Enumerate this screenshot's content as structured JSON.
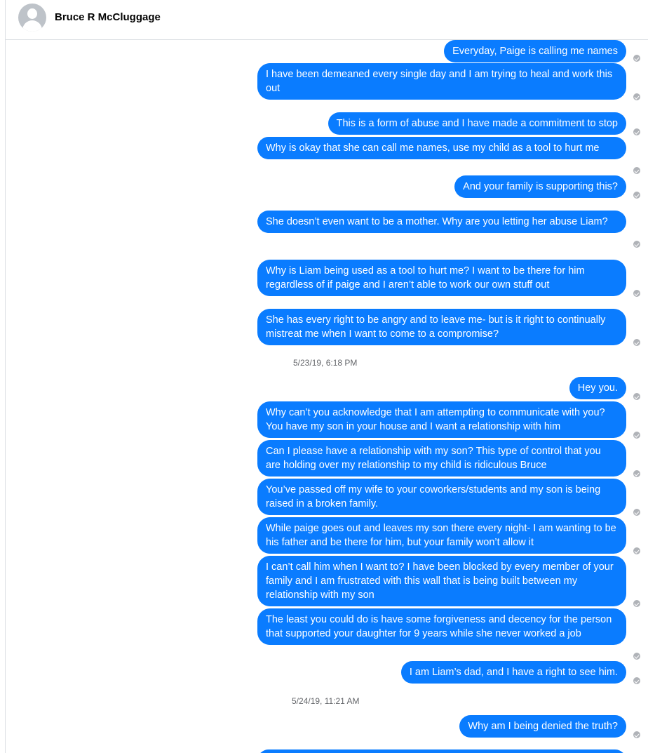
{
  "contact": {
    "name": "Bruce R McCluggage"
  },
  "messages": [
    "Everyday, Paige is calling me names",
    "I have been demeaned every single day and I am trying to heal and work this out",
    "This is a form of abuse and I have made a commitment to stop",
    "Why is okay that she can call me names, use my child as a tool to hurt me",
    "And your family is supporting this?",
    "She doesn’t even want to be a mother. Why are you letting her abuse Liam?",
    "Why is Liam being used as a tool to hurt me? I want to be there for him regardless of if paige and I aren’t able to work our own stuff out",
    "She has every right to be angry and to leave me- but is it right to continually mistreat me when I want to come to a compromise?",
    "Hey you.",
    "Why can’t you acknowledge that I am attempting to communicate with you? You have my son in your house and I want a relationship with him",
    "Can I please have a relationship with my son? This type of control that you are holding over my relationship to my child is ridiculous Bruce",
    "You’ve passed off my wife to your coworkers/students and my son is being raised in a broken family.",
    "While paige goes out and leaves my son there every night- I am wanting to be his father and be there for him, but your family won’t allow it",
    "I can’t call him when I want to? I have been blocked by every member of your family and I am frustrated with this wall that is being built between my relationship with my son",
    "The least you could do is have some forgiveness and decency for the person that supported your daughter for 9 years while she never worked a job",
    "I am Liam’s dad, and I have a right to see him.",
    "Why am I being denied the truth?"
  ],
  "timestamps": [
    "5/23/19, 6:18 PM",
    "5/24/19, 11:21 AM"
  ]
}
